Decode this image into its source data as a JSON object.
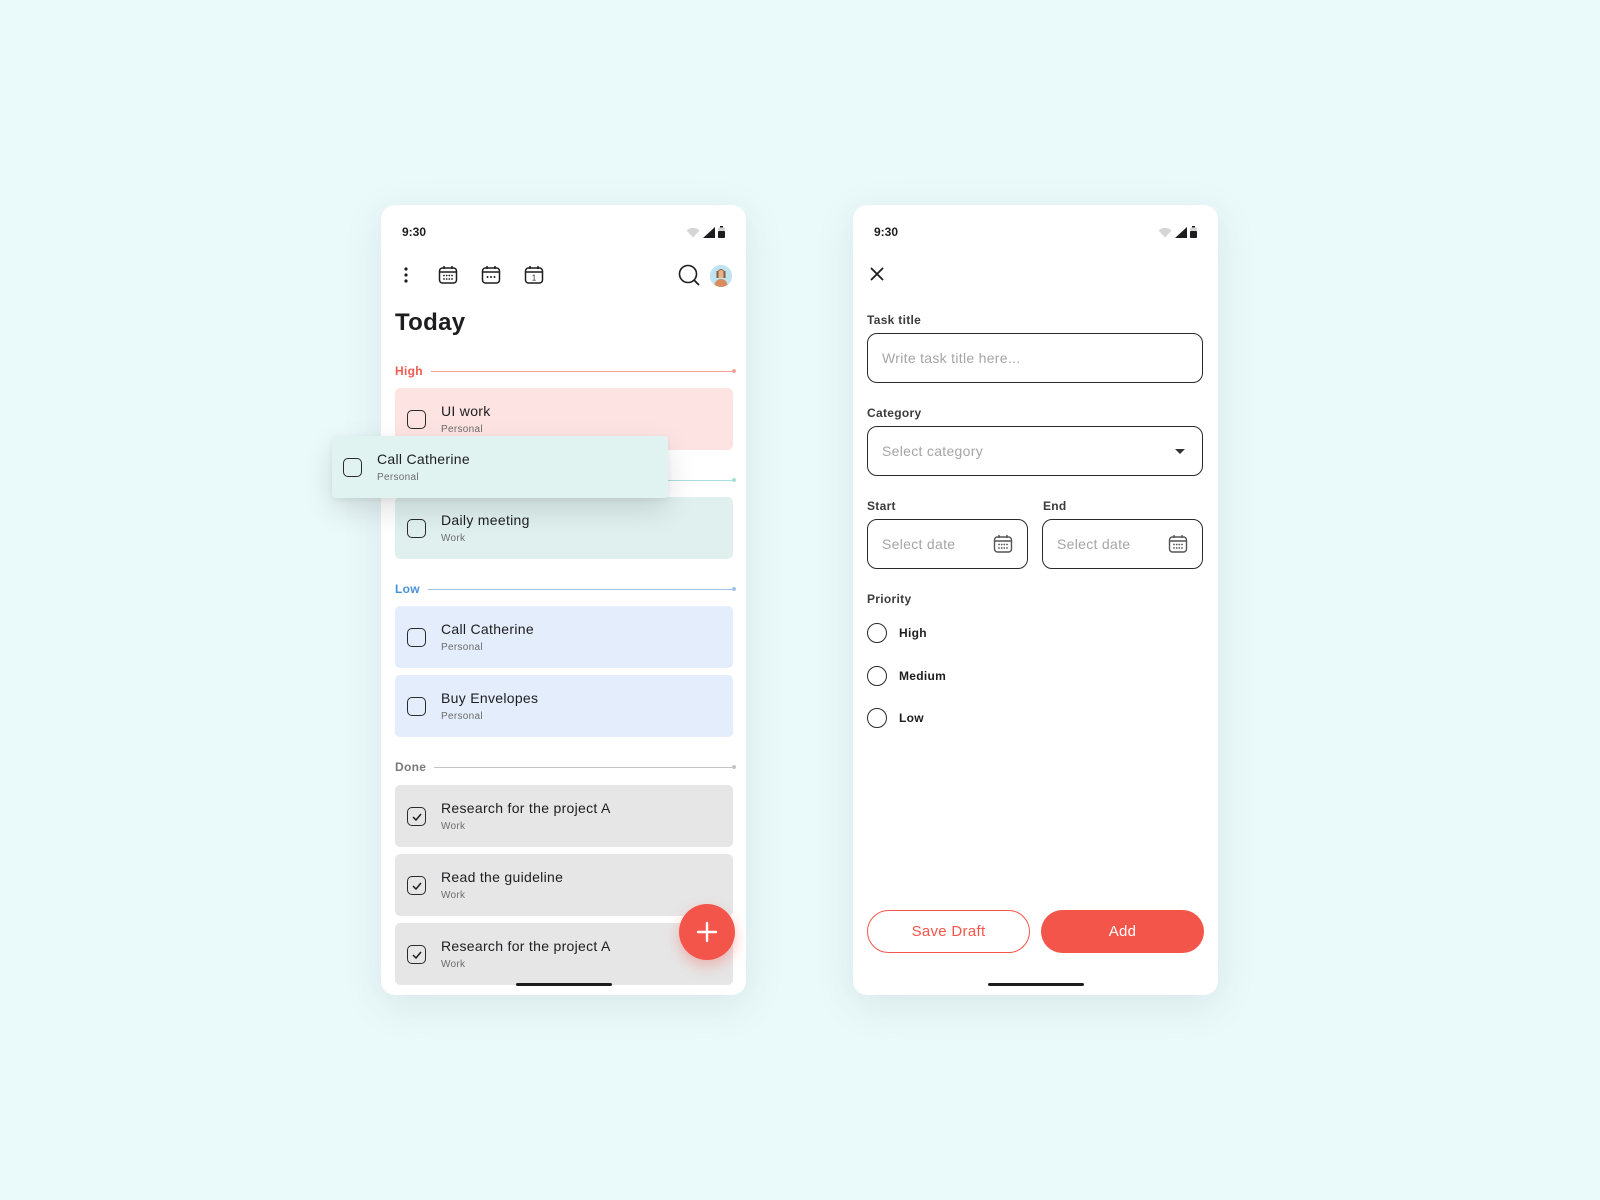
{
  "colors": {
    "background": "#eaf9f9",
    "accent": "#f4554a",
    "high": "#f25b52",
    "medium": "#7fd3cc",
    "low": "#4a90d9",
    "done": "#8a8a8a"
  },
  "list_screen": {
    "status": {
      "time": "9:30",
      "icons": [
        "wifi-icon",
        "signal-icon",
        "battery-icon"
      ]
    },
    "toolbar": {
      "icons": [
        "more-vert-icon",
        "calendar-month-icon",
        "calendar-week-icon",
        "calendar-day-icon",
        "search-icon",
        "avatar"
      ],
      "day_number": "1"
    },
    "title": "Today",
    "sections": [
      {
        "label": "High",
        "tasks": [
          {
            "title": "UI work",
            "category": "Personal",
            "done": false
          }
        ]
      },
      {
        "label": "",
        "tasks": [
          {
            "title": "Daily meeting",
            "category": "Work",
            "done": false
          }
        ]
      },
      {
        "label": "Low",
        "tasks": [
          {
            "title": "Call Catherine",
            "category": "Personal",
            "done": false
          },
          {
            "title": "Buy Envelopes",
            "category": "Personal",
            "done": false
          }
        ]
      },
      {
        "label": "Done",
        "tasks": [
          {
            "title": "Research for the project A",
            "category": "Work",
            "done": true
          },
          {
            "title": "Read the guideline",
            "category": "Work",
            "done": true
          },
          {
            "title": "Research for the project A",
            "category": "Work",
            "done": true
          }
        ]
      }
    ],
    "dragging_task": {
      "title": "Call Catherine",
      "category": "Personal",
      "done": false
    },
    "fab_icon": "plus-icon"
  },
  "form_screen": {
    "status": {
      "time": "9:30"
    },
    "close_icon": "close-icon",
    "task_title": {
      "label": "Task title",
      "placeholder": "Write task title here...",
      "value": ""
    },
    "category": {
      "label": "Category",
      "placeholder": "Select category"
    },
    "start": {
      "label": "Start",
      "placeholder": "Select date"
    },
    "end": {
      "label": "End",
      "placeholder": "Select date"
    },
    "priority": {
      "label": "Priority",
      "options": [
        "High",
        "Medium",
        "Low"
      ],
      "selected": null
    },
    "buttons": {
      "save_draft": "Save Draft",
      "add": "Add"
    }
  }
}
